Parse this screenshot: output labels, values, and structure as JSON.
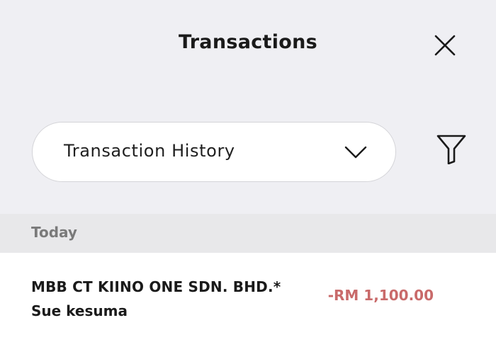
{
  "header": {
    "title": "Transactions",
    "close_icon": "close-icon"
  },
  "filter_bar": {
    "dropdown_value": "Transaction History",
    "dropdown_icon": "chevron-down-icon",
    "filter_icon": "filter-icon"
  },
  "sections": [
    {
      "label": "Today",
      "transactions": [
        {
          "title": "MBB CT KIINO ONE SDN. BHD.*",
          "subtitle": "Sue kesuma",
          "amount": "-RM 1,100.00"
        }
      ]
    }
  ],
  "colors": {
    "background_top": "#efeff3",
    "section_header": "#e8e8ea",
    "amount_negative": "#c96a6a"
  }
}
